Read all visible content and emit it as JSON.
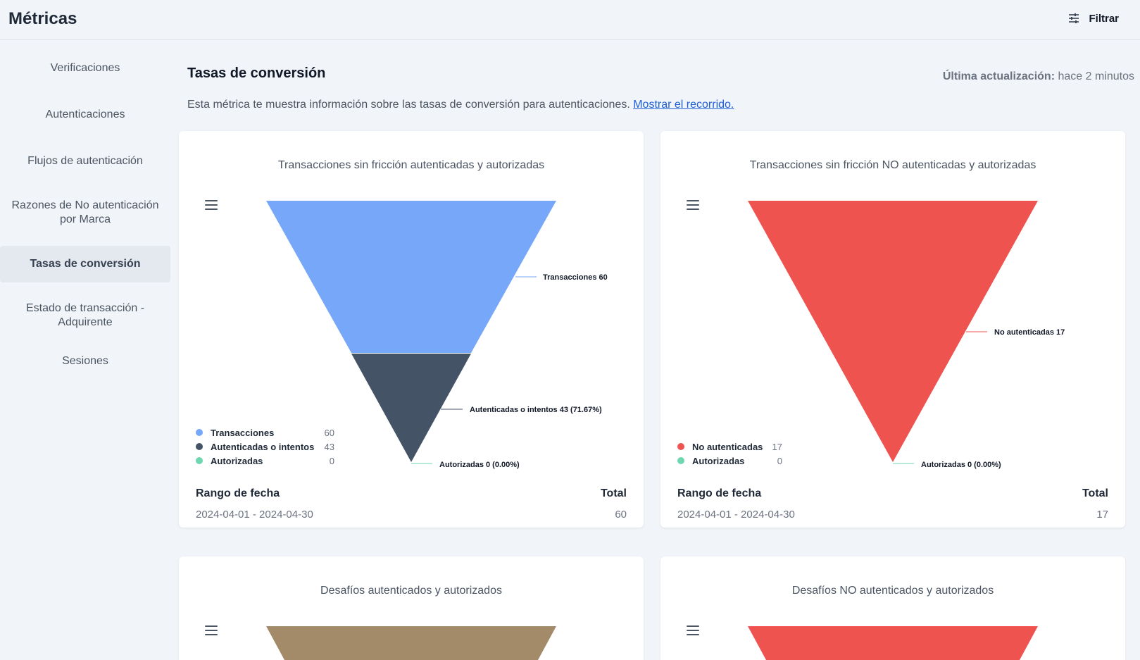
{
  "app": {
    "title": "Métricas",
    "filter_label": "Filtrar"
  },
  "sidebar": {
    "items": [
      {
        "label": "Verificaciones",
        "active": false
      },
      {
        "label": "Autenticaciones",
        "active": false
      },
      {
        "label": "Flujos de autenticación",
        "active": false
      },
      {
        "label": "Razones de No autenticación por Marca",
        "active": false
      },
      {
        "label": "Tasas de conversión",
        "active": true
      },
      {
        "label": "Estado de transacción - Adquirente",
        "active": false
      },
      {
        "label": "Sesiones",
        "active": false
      }
    ]
  },
  "main": {
    "title": "Tasas de conversión",
    "last_update_label": "Última actualización:",
    "last_update_value": "hace 2 minutos",
    "description": "Esta métrica te muestra información sobre las tasas de conversión para autenticaciones.",
    "tour_link": "Mostrar el recorrido."
  },
  "cards": [
    {
      "title": "Transacciones sin fricción autenticadas y autorizadas",
      "date_range_label": "Rango de fecha",
      "total_label": "Total",
      "date_range": "2024-04-01 - 2024-04-30",
      "total": "60",
      "legend": [
        {
          "label": "Transacciones",
          "value": "60",
          "color": "#77a7f9"
        },
        {
          "label": "Autenticadas o intentos",
          "value": "43",
          "color": "#445366"
        },
        {
          "label": "Autorizadas",
          "value": "0",
          "color": "#6fd6b0"
        }
      ],
      "data_labels": [
        "Transacciones 60",
        "Autenticadas o intentos 43 (71.67%)",
        "Autorizadas 0 (0.00%)"
      ]
    },
    {
      "title": "Transacciones sin fricción NO autenticadas y autorizadas",
      "date_range_label": "Rango de fecha",
      "total_label": "Total",
      "date_range": "2024-04-01 - 2024-04-30",
      "total": "17",
      "legend": [
        {
          "label": "No autenticadas",
          "value": "17",
          "color": "#ef5350"
        },
        {
          "label": "Autorizadas",
          "value": "0",
          "color": "#6fd6b0"
        }
      ],
      "data_labels": [
        "No autenticadas 17",
        "Autorizadas 0 (0.00%)"
      ]
    },
    {
      "title": "Desafíos autenticados y autorizados",
      "top_color": "#a38a68"
    },
    {
      "title": "Desafíos NO autenticados y autorizados",
      "top_color": "#ef5350"
    }
  ],
  "chart_data": [
    {
      "type": "funnel",
      "title": "Transacciones sin fricción autenticadas y autorizadas",
      "categories": [
        "Transacciones",
        "Autenticadas o intentos",
        "Autorizadas"
      ],
      "values": [
        60,
        43,
        0
      ],
      "percentages": [
        null,
        71.67,
        0.0
      ],
      "colors": [
        "#77a7f9",
        "#445366",
        "#6fd6b0"
      ]
    },
    {
      "type": "funnel",
      "title": "Transacciones sin fricción NO autenticadas y autorizadas",
      "categories": [
        "No autenticadas",
        "Autorizadas"
      ],
      "values": [
        17,
        0
      ],
      "percentages": [
        null,
        0.0
      ],
      "colors": [
        "#ef5350",
        "#6fd6b0"
      ]
    }
  ]
}
